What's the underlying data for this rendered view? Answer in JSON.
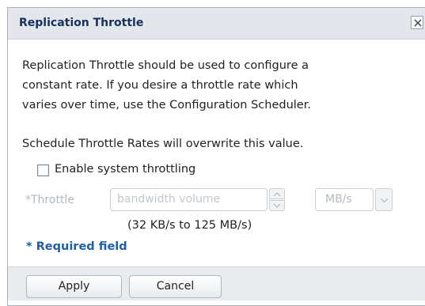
{
  "dialog": {
    "title": "Replication Throttle",
    "close_icon": "close-icon"
  },
  "content": {
    "description_lines": [
      "Replication Throttle should be used to configure a",
      "constant rate. If you desire a throttle rate which",
      "varies over time, use the Configuration Scheduler."
    ],
    "overwrite_note": "Schedule Throttle Rates will overwrite this value."
  },
  "throttling": {
    "enable_label": "Enable system throttling",
    "enabled": false,
    "throttle_label": "*Throttle",
    "placeholder": "bandwidth volume",
    "value": "",
    "unit": "MB/s",
    "range": "(32 KB/s to 125 MB/s)"
  },
  "required_note": "* Required field",
  "footer": {
    "apply_label": "Apply",
    "cancel_label": "Cancel"
  },
  "colors": {
    "title_text": "#14325c",
    "required_text": "#1f5fa8",
    "disabled_text": "#b3b9bf"
  }
}
